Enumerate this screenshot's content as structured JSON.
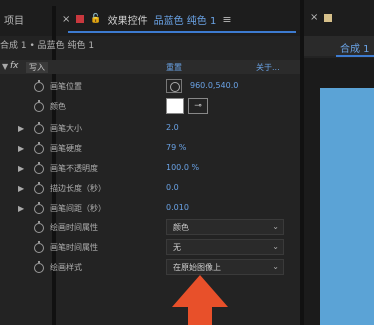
{
  "tabs": {
    "project": "项目",
    "effects_title": "效果控件",
    "effects_layer": "品蓝色 纯色 1",
    "comp_tab": "合成 1"
  },
  "breadcrumb": "合成 1 • 品蓝色 纯色 1",
  "effect": {
    "fx_label": "fx",
    "name": "写入",
    "reset": "重置",
    "about": "关于..."
  },
  "properties": [
    {
      "label": "画笔位置",
      "value": "960.0,540.0"
    },
    {
      "label": "颜色"
    },
    {
      "label": "画笔大小",
      "value": "2.0"
    },
    {
      "label": "画笔硬度",
      "value": "79 %"
    },
    {
      "label": "画笔不透明度",
      "value": "100.0 %"
    },
    {
      "label": "描边长度（秒）",
      "value": "0.0"
    },
    {
      "label": "画笔间距（秒）",
      "value": "0.010"
    },
    {
      "label": "绘画时间属性",
      "value": "颜色"
    },
    {
      "label": "画笔时间属性",
      "value": "无"
    },
    {
      "label": "绘画样式",
      "value": "在原始图像上"
    }
  ],
  "colors": {
    "accent": "#6aa3e6",
    "layer_swatch": "#c9383e",
    "canvas": "#5ba3d6",
    "arrow": "#e8502a"
  }
}
